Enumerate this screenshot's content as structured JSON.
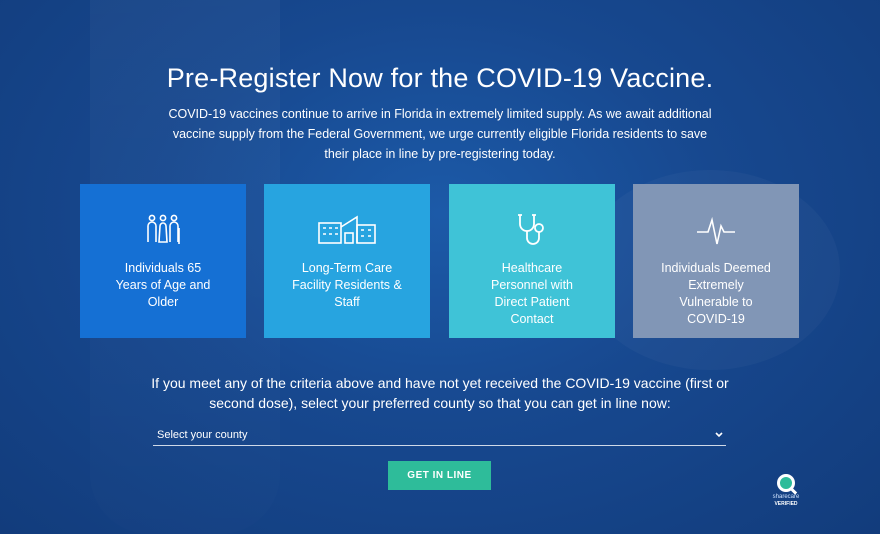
{
  "header": {
    "title": "Pre-Register Now for the COVID-19 Vaccine.",
    "intro": "COVID-19 vaccines continue to arrive in Florida in extremely limited supply. As we await additional vaccine supply from the Federal Government, we urge currently eligible Florida residents to save their place in line by pre-registering today."
  },
  "cards": [
    {
      "label": "Individuals 65 Years of Age and Older",
      "icon": "seniors-icon",
      "color": "#1570d4"
    },
    {
      "label": "Long-Term Care Facility Residents & Staff",
      "icon": "facility-icon",
      "color": "#27a4e0"
    },
    {
      "label": "Healthcare Personnel with Direct Patient Contact",
      "icon": "stethoscope-icon",
      "color": "#3fc3d7"
    },
    {
      "label": "Individuals Deemed Extremely Vulnerable to COVID-19",
      "icon": "heartbeat-icon",
      "color": "#8196b6"
    }
  ],
  "form": {
    "criteria_text": "If you meet any of the criteria above and have not yet received the COVID-19 vaccine (first or second dose), select your preferred county so that you can get in line now:",
    "county_select": "Select your county",
    "submit_label": "GET IN LINE",
    "submit_color": "#2ebc9a"
  },
  "badge": {
    "line1": "sharecare",
    "line2": "VERIFIED"
  }
}
